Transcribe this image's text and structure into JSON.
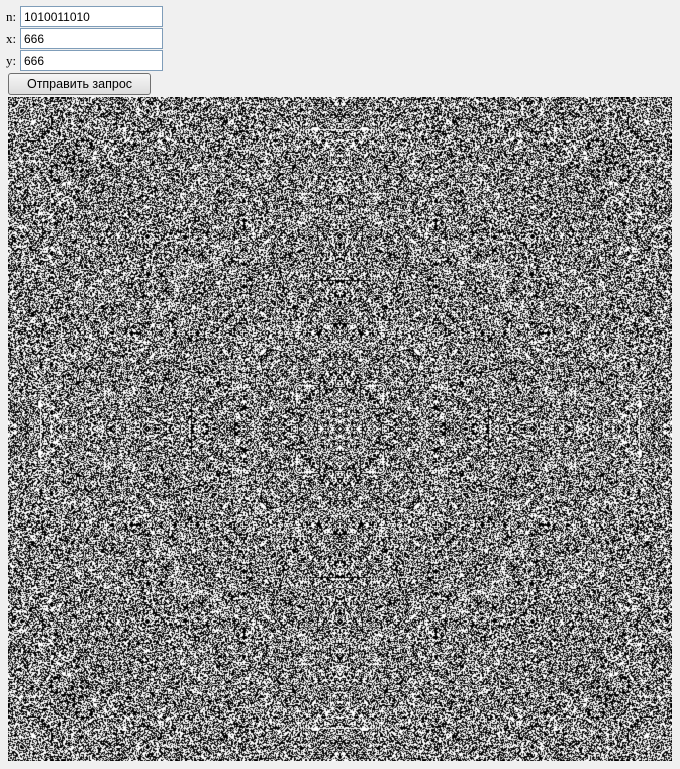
{
  "form": {
    "n_label": "n:",
    "n_value": "1010011010",
    "x_label": "x:",
    "x_value": "666",
    "y_label": "y:",
    "y_value": "666",
    "submit_label": "Отправить запрос"
  },
  "colors": {
    "background": "#f0f0f0",
    "pattern_dark": "#000000",
    "pattern_light": "#ffffff"
  }
}
